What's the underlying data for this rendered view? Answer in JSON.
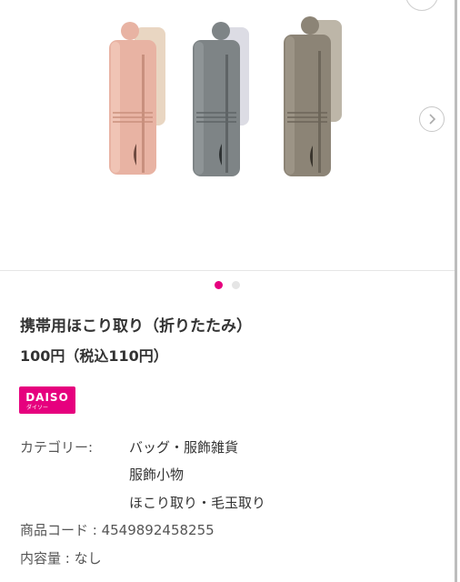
{
  "product": {
    "title": "携帯用ほこり取り（折りたたみ）",
    "price": "100円（税込110円）"
  },
  "brand": {
    "logo_text": "DAISO",
    "logo_subtext": "ダイソー",
    "color": "#e6007e"
  },
  "carousel": {
    "slide_count": 2,
    "active_index": 0,
    "next_icon": "chevron-right-icon",
    "item_colors": [
      "#e8b3a3",
      "#7e8486",
      "#8c8476"
    ]
  },
  "details": {
    "category_label": "カテゴリー:",
    "categories": [
      "バッグ・服飾雑貨",
      "服飾小物",
      "ほこり取り・毛玉取り"
    ],
    "product_code": "商品コード : 4549892458255",
    "contents": "内容量 : なし"
  },
  "colors": {
    "accent": "#e6007e",
    "text": "#333333",
    "divider": "#e6e6e6"
  }
}
